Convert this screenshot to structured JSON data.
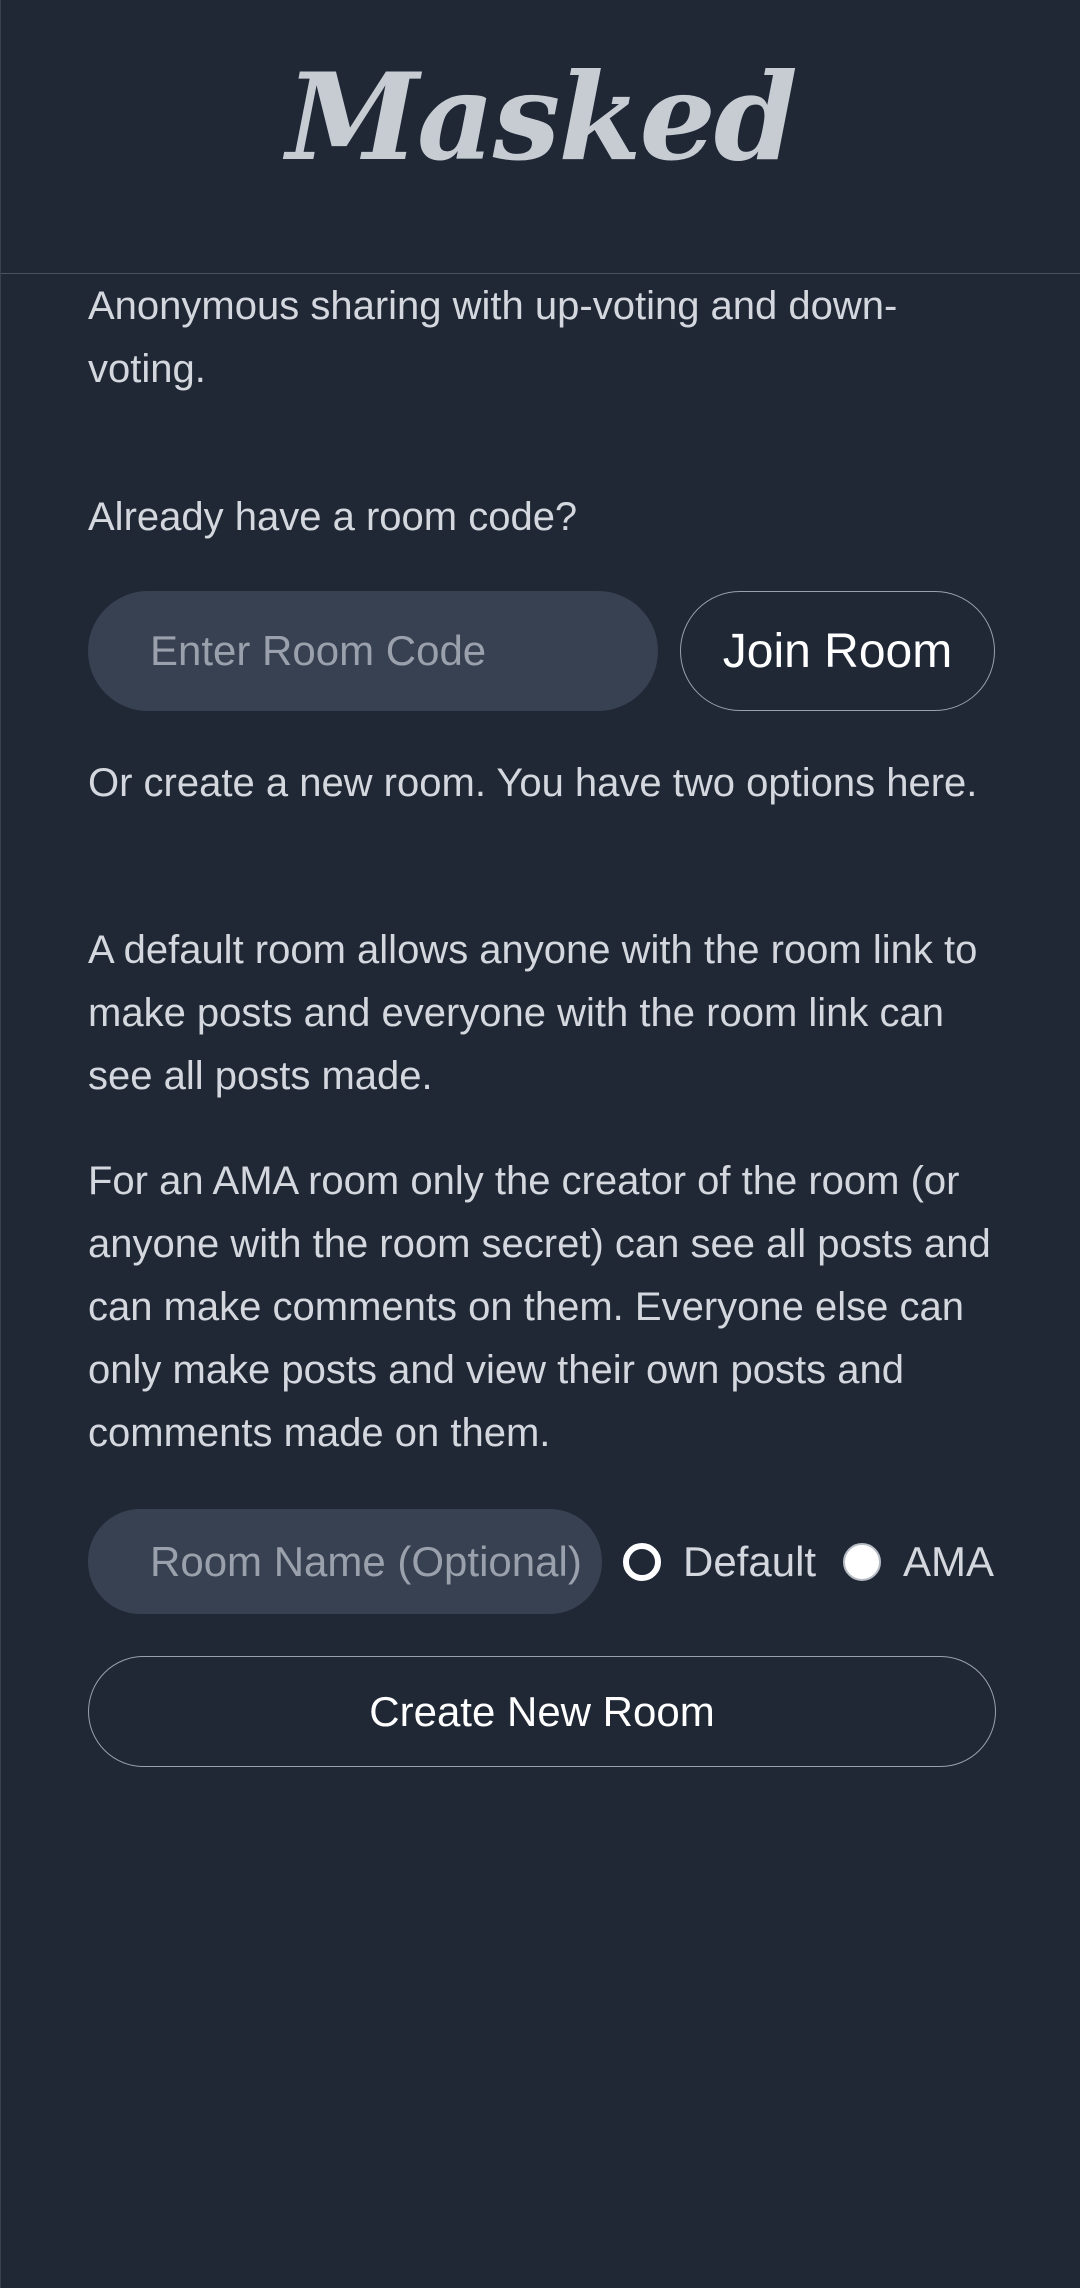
{
  "header": {
    "logo_text": "Masked"
  },
  "intro": {
    "tagline": "Anonymous sharing with up-voting and down-voting."
  },
  "join": {
    "prompt": "Already have a room code?",
    "code_placeholder": "Enter Room Code",
    "join_label": "Join Room"
  },
  "create": {
    "intro": "Or create a new room. You have two options here.",
    "default_description": "A default room allows anyone with the room link to make posts and everyone with the room link can see all posts made.",
    "ama_description": "For an AMA room only the creator of the room (or anyone with the room secret) can see all posts and can make comments on them. Everyone else can only make posts and view their own posts and comments made on them.",
    "name_placeholder": "Room Name (Optional)",
    "options": [
      {
        "label": "Default",
        "selected": true
      },
      {
        "label": "AMA",
        "selected": false
      }
    ],
    "create_label": "Create New Room"
  },
  "colors": {
    "background": "#202836",
    "input_background": "#374151",
    "text": "#d4d8de",
    "button_text": "#ffffff",
    "border": "#9aa1ac"
  }
}
